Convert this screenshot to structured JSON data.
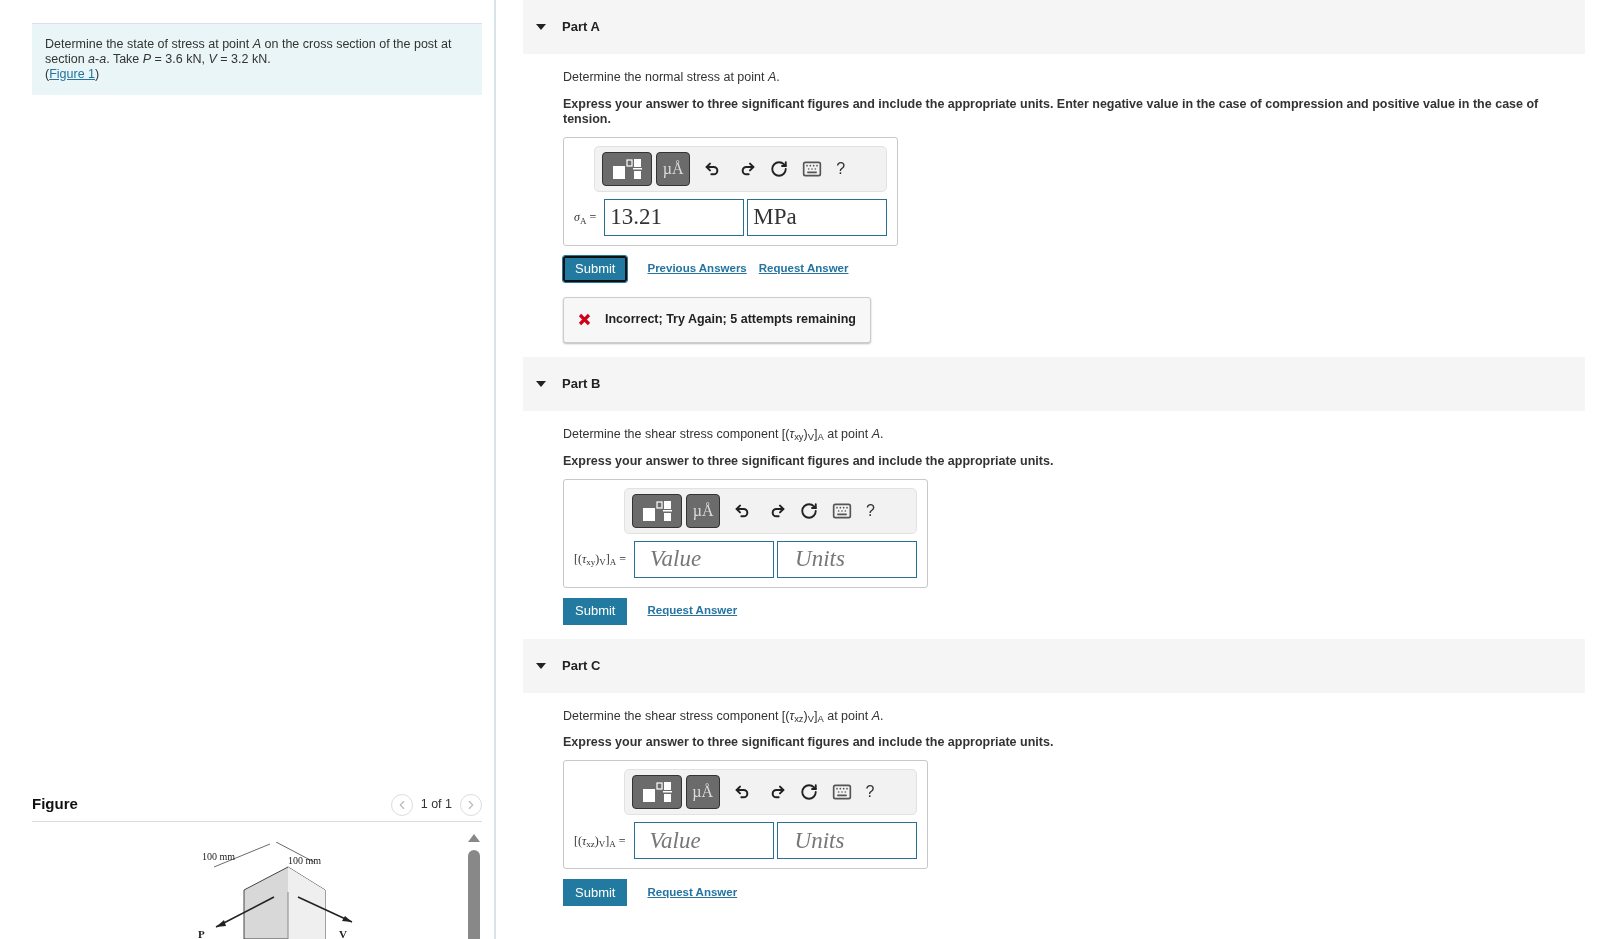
{
  "problem": {
    "text": "Determine the state of stress at point *A* on the cross section of the post at section *a*-*a*. Take *P* = 3.6 kN, *V* = 3.2 kN.",
    "figure_link": {
      "prefix": "(",
      "label": "Figure 1",
      "suffix": ")"
    }
  },
  "figure": {
    "title": "Figure",
    "pager": "1 of 1",
    "prev_disabled": true,
    "next_disabled": true,
    "labels": [
      "100 mm",
      "100 mm",
      "P",
      "V"
    ]
  },
  "parts": [
    {
      "title": "Part A",
      "expanded": true,
      "question": "Determine the normal stress at point *A*.",
      "instruction": "Express your answer to three significant figures and include the appropriate units. Enter negative value in the case of compression and positive value in the case of tension.",
      "toolbar": {
        "units_button": "µÅ",
        "help": "?"
      },
      "label": "*σ*$_{A}$ =",
      "value": {
        "text": "13.21"
      },
      "units": {
        "text": "MPa"
      },
      "submit": {
        "label": "Submit",
        "focused": true
      },
      "links": [
        "Previous Answers",
        "Request Answer"
      ],
      "feedback": {
        "kind": "incorrect",
        "text": "Incorrect; Try Again; 5 attempts remaining"
      }
    },
    {
      "title": "Part B",
      "expanded": true,
      "question": "Determine the shear stress component [(*τ*$_{xy}$)$_{V}$]$_{A}$ at point *A*.",
      "instruction": "Express your answer to three significant figures and include the appropriate units.",
      "toolbar": {
        "units_button": "µÅ",
        "help": "?"
      },
      "label": "[(*τ*$_{xy}$)$_{V}$]$_{A}$ =",
      "value": {
        "placeholder": "Value"
      },
      "units": {
        "placeholder": "Units"
      },
      "submit": {
        "label": "Submit",
        "focused": false
      },
      "links": [
        "Request Answer"
      ]
    },
    {
      "title": "Part C",
      "expanded": true,
      "question": "Determine the shear stress component [(*τ*$_{xz}$)$_{V}$]$_{A}$ at point *A*.",
      "instruction": "Express your answer to three significant figures and include the appropriate units.",
      "toolbar": {
        "units_button": "µÅ",
        "help": "?"
      },
      "label": "[(*τ*$_{xz}$)$_{V}$]$_{A}$ =",
      "value": {
        "placeholder": "Value"
      },
      "units": {
        "placeholder": "Units"
      },
      "submit": {
        "label": "Submit",
        "focused": false
      },
      "links": [
        "Request Answer"
      ]
    }
  ]
}
